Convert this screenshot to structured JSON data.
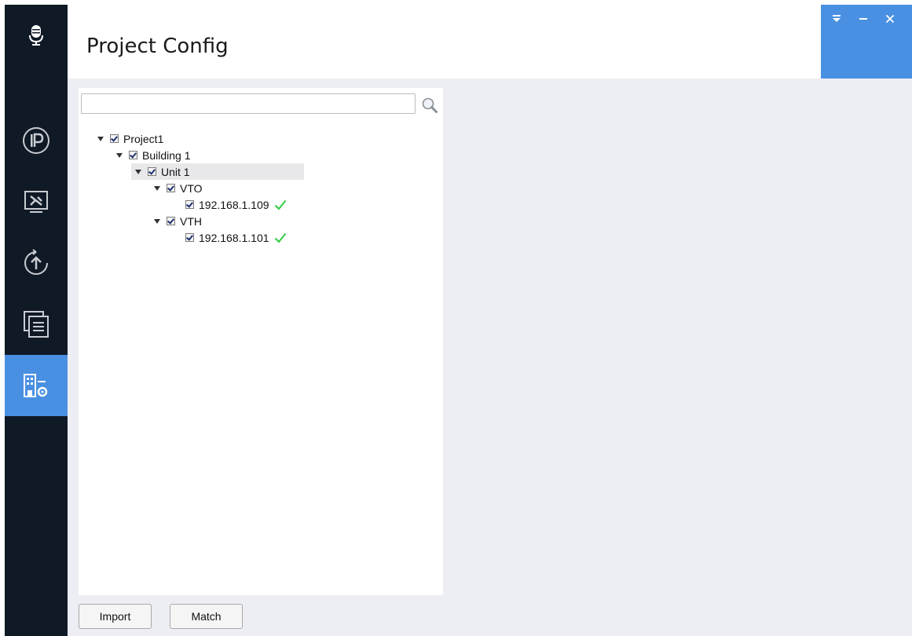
{
  "header": {
    "title": "Project Config"
  },
  "sidebar": {
    "items": [
      {
        "icon": "microphone-icon",
        "active": false
      },
      {
        "icon": "ip-config-icon",
        "active": false
      },
      {
        "icon": "device-tools-icon",
        "active": false
      },
      {
        "icon": "upgrade-icon",
        "active": false
      },
      {
        "icon": "records-icon",
        "active": false
      },
      {
        "icon": "building-settings-icon",
        "active": true
      }
    ]
  },
  "window_controls": [
    "dropdown-icon",
    "minimize-icon",
    "close-icon"
  ],
  "search": {
    "value": "",
    "placeholder": ""
  },
  "tree": [
    {
      "label": "Project1",
      "level": 0,
      "expanded": true,
      "checked": true
    },
    {
      "label": "Building 1",
      "level": 1,
      "expanded": true,
      "checked": true
    },
    {
      "label": "Unit 1",
      "level": 2,
      "expanded": true,
      "checked": true,
      "selected": true
    },
    {
      "label": "VTO",
      "level": 3,
      "expanded": true,
      "checked": true
    },
    {
      "label": "192.168.1.109",
      "level": 4,
      "checked": true,
      "status": "ok"
    },
    {
      "label": "VTH",
      "level": 3,
      "expanded": true,
      "checked": true
    },
    {
      "label": "192.168.1.101",
      "level": 4,
      "checked": true,
      "status": "ok"
    }
  ],
  "buttons": {
    "import": "Import",
    "match": "Match"
  },
  "colors": {
    "sidebar_bg": "#101a26",
    "accent": "#4a90e2",
    "content_bg": "#edeef3",
    "ok_check": "#2ecc40"
  }
}
